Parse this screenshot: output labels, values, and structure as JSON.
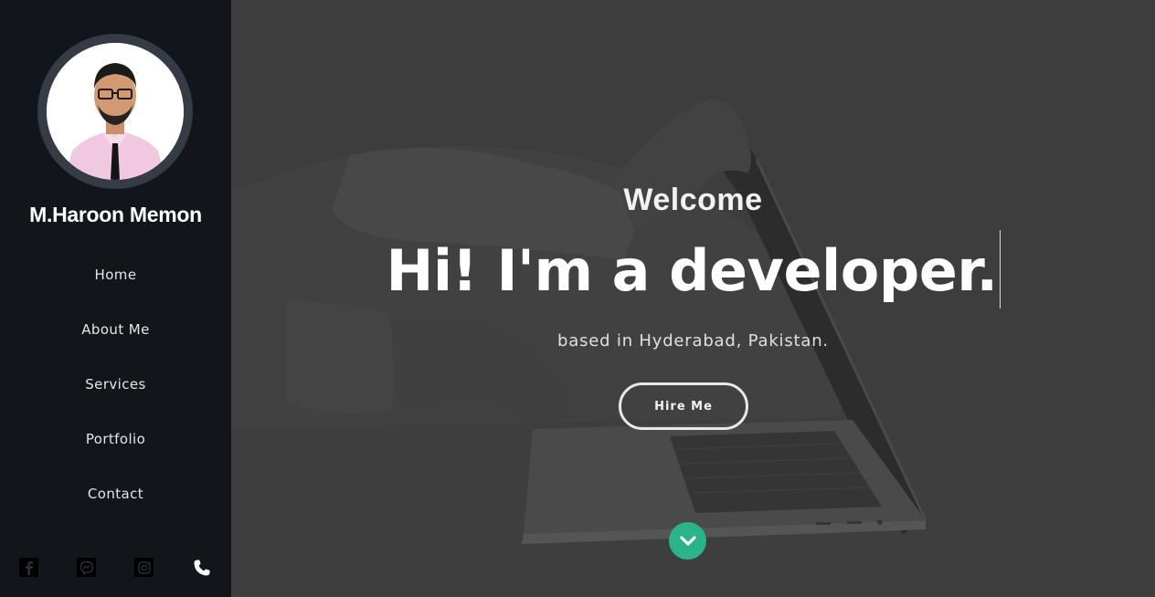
{
  "profile": {
    "name": "M.Haroon Memon"
  },
  "nav": {
    "items": [
      "Home",
      "About Me",
      "Services",
      "Portfolio",
      "Contact"
    ]
  },
  "social": {
    "icons": [
      "facebook-icon",
      "messenger-icon",
      "instagram-icon",
      "phone-icon"
    ]
  },
  "hero": {
    "welcome": "Welcome",
    "headline": "Hi! I'm a developer.",
    "location": "based in Hyderabad, Pakistan.",
    "cta_label": "Hire Me",
    "scroll_icon": "chevron-down-icon"
  },
  "colors": {
    "sidebar_bg": "#12151a",
    "accent": "#2bb38a",
    "hero_overlay": "#3f3f3f"
  }
}
